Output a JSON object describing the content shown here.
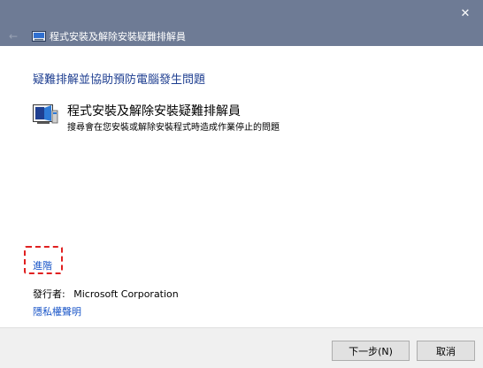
{
  "window": {
    "title": "程式安裝及解除安裝疑難排解員",
    "close_glyph": "✕",
    "back_glyph": "←"
  },
  "content": {
    "heading": "疑難排解並協助預防電腦發生問題",
    "item_title": "程式安裝及解除安裝疑難排解員",
    "item_description": "搜尋會在您安裝或解除安裝程式時造成作業停止的問題",
    "advanced_link": "進階",
    "publisher_label": "發行者:",
    "publisher_name": "Microsoft Corporation",
    "privacy_link": "隱私權聲明"
  },
  "footer": {
    "next_button": "下一步(N)",
    "cancel_button": "取消"
  },
  "colors": {
    "titlebar": "#6e7b95",
    "heading": "#1f3f91",
    "link": "#1a56c8",
    "highlight_border": "#e02020",
    "footer_bg": "#f0f0f0"
  }
}
